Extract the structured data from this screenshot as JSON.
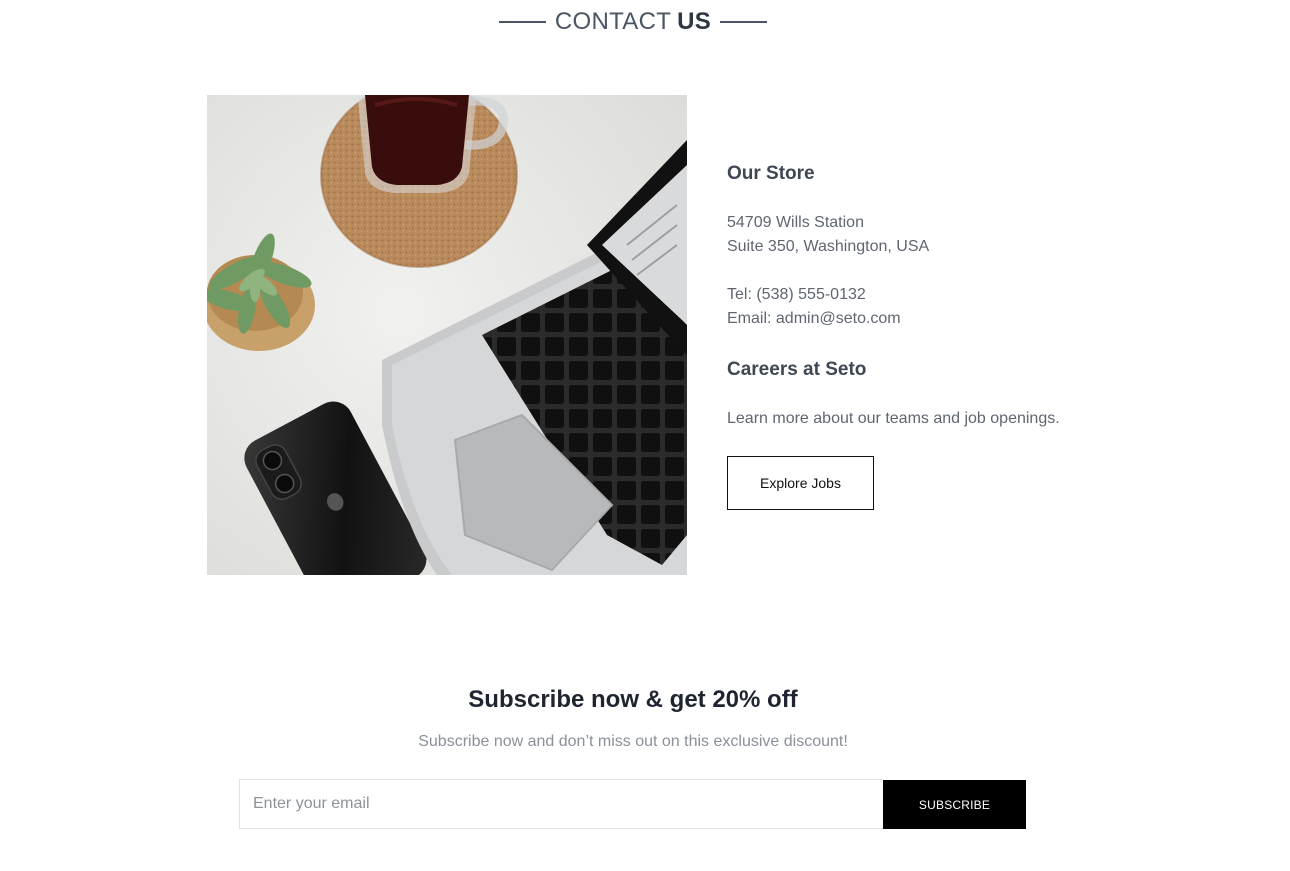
{
  "section_heading": {
    "light": "CONTACT",
    "strong": "US"
  },
  "photo": {
    "alt": "Desk with coffee cup on cork coaster, succulent plant, smartphone and laptop"
  },
  "store": {
    "title": "Our Store",
    "address_line1": "54709 Wills Station",
    "address_line2": "Suite 350, Washington, USA",
    "tel": "Tel: (538) 555-0132",
    "email": "Email: admin@seto.com"
  },
  "careers": {
    "title": "Careers at Seto",
    "text": "Learn more about our teams and job openings.",
    "button_label": "Explore Jobs"
  },
  "subscribe": {
    "title": "Subscribe now & get 20% off",
    "subtitle": "Subscribe now and don’t miss out on this exclusive discount!",
    "placeholder": "Enter your email",
    "button_label": "SUBSCRIBE"
  }
}
